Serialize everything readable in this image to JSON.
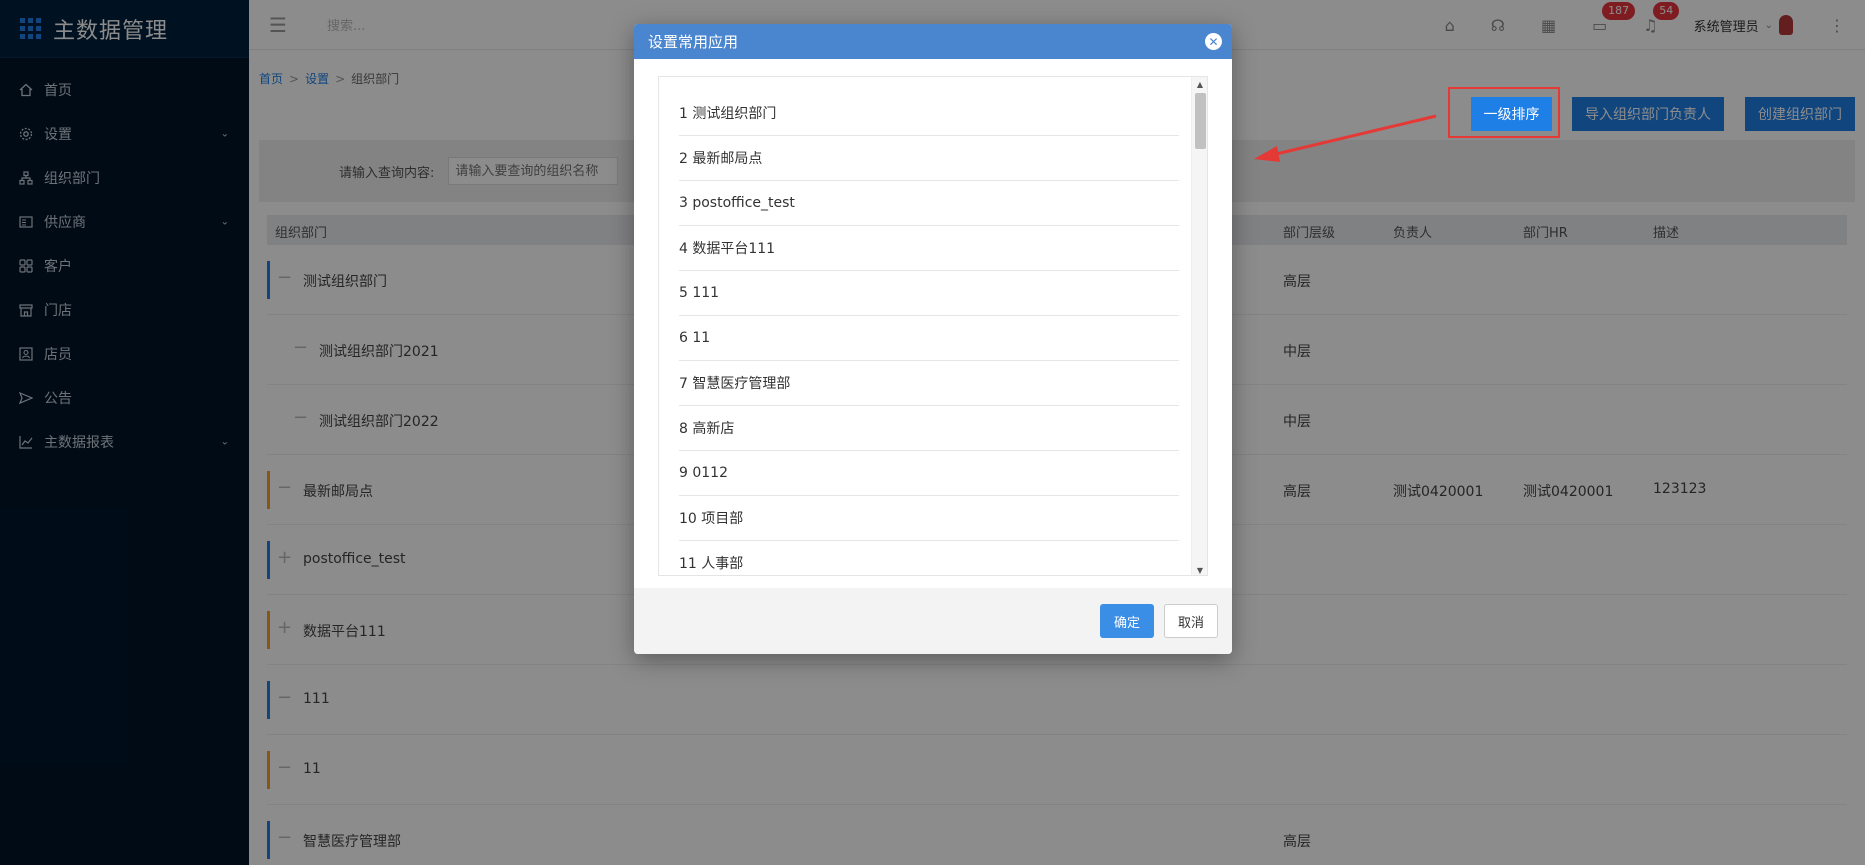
{
  "app": {
    "title": "主数据管理"
  },
  "sidebar": {
    "items": [
      {
        "label": "首页",
        "icon": "home-icon",
        "has_children": false
      },
      {
        "label": "设置",
        "icon": "gear-icon",
        "has_children": true
      },
      {
        "label": "组织部门",
        "icon": "org-tree-icon",
        "has_children": false
      },
      {
        "label": "供应商",
        "icon": "supplier-icon",
        "has_children": true
      },
      {
        "label": "客户",
        "icon": "customer-icon",
        "has_children": false
      },
      {
        "label": "门店",
        "icon": "store-icon",
        "has_children": false
      },
      {
        "label": "店员",
        "icon": "staff-icon",
        "has_children": false
      },
      {
        "label": "公告",
        "icon": "announce-icon",
        "has_children": false
      },
      {
        "label": "主数据报表",
        "icon": "chart-icon",
        "has_children": true
      }
    ]
  },
  "topbar": {
    "search_placeholder": "搜索...",
    "badge_messages": "187",
    "badge_notifications": "54",
    "user_name": "系统管理员"
  },
  "breadcrumb": {
    "home": "首页",
    "settings": "设置",
    "current": "组织部门"
  },
  "toolbar": {
    "sort_label": "一级排序",
    "import_label": "导入组织部门负责人",
    "create_label": "创建组织部门"
  },
  "filter": {
    "label": "请输入查询内容:",
    "placeholder": "请输入要查询的组织名称"
  },
  "table": {
    "headers": {
      "dept": "组织部门",
      "level": "部门层级",
      "owner": "负责人",
      "hr": "部门HR",
      "desc": "描述"
    },
    "rows": [
      {
        "name": "测试组织部门",
        "level": "高层",
        "owner": "",
        "hr": "",
        "desc": "",
        "indent": 0,
        "toggle": "−",
        "color": "#1e7fe6"
      },
      {
        "name": "测试组织部门2021",
        "level": "中层",
        "owner": "",
        "hr": "",
        "desc": "",
        "indent": 1,
        "toggle": "−",
        "color": ""
      },
      {
        "name": "测试组织部门2022",
        "level": "中层",
        "owner": "",
        "hr": "",
        "desc": "",
        "indent": 1,
        "toggle": "−",
        "color": ""
      },
      {
        "name": "最新邮局点",
        "level": "高层",
        "owner": "测试0420001",
        "hr": "测试0420001",
        "desc": "123123",
        "indent": 0,
        "toggle": "−",
        "color": "#f0a020"
      },
      {
        "name": "postoffice_test",
        "level": "",
        "owner": "",
        "hr": "",
        "desc": "",
        "indent": 0,
        "toggle": "+",
        "color": "#1e7fe6"
      },
      {
        "name": "数据平台111",
        "level": "",
        "owner": "",
        "hr": "",
        "desc": "",
        "indent": 0,
        "toggle": "+",
        "color": "#f0a020"
      },
      {
        "name": "111",
        "level": "",
        "owner": "",
        "hr": "",
        "desc": "",
        "indent": 0,
        "toggle": "−",
        "color": "#1e7fe6"
      },
      {
        "name": "11",
        "level": "",
        "owner": "",
        "hr": "",
        "desc": "",
        "indent": 0,
        "toggle": "−",
        "color": "#f0a020"
      },
      {
        "name": "智慧医疗管理部",
        "level": "高层",
        "owner": "",
        "hr": "",
        "desc": "",
        "indent": 0,
        "toggle": "−",
        "color": "#1e7fe6"
      }
    ]
  },
  "modal": {
    "title": "设置常用应用",
    "items": [
      "1 测试组织部门",
      "2 最新邮局点",
      "3 postoffice_test",
      "4 数据平台111",
      "5 111",
      "6 11",
      "7 智慧医疗管理部",
      "8 高新店",
      "9 0112",
      "10 项目部",
      "11 人事部"
    ],
    "ok_label": "确定",
    "cancel_label": "取消"
  },
  "colors": {
    "primary": "#1e7fe6",
    "sidebar_bg": "#001529",
    "modal_header": "#4a85d0",
    "annotation": "#e53935"
  }
}
